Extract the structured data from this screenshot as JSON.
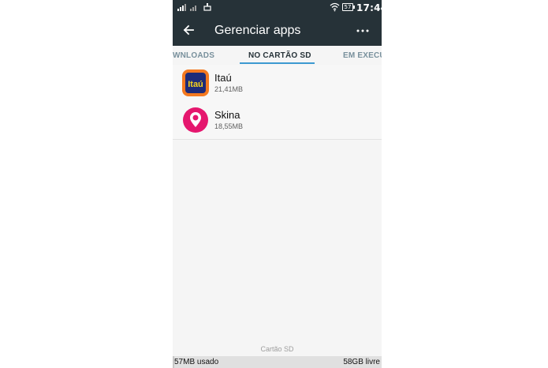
{
  "status_bar": {
    "time": "17:44",
    "battery": "57",
    "icons": [
      "signal-icon",
      "signal-icon",
      "usb-icon",
      "wifi-icon",
      "battery-icon"
    ]
  },
  "app_bar": {
    "title": "Gerenciar apps",
    "back_icon": "arrow-left-icon",
    "menu_icon": "more-horizontal-icon"
  },
  "tabs": [
    {
      "label": "WNLOADS"
    },
    {
      "label": "NO CARTÃO SD"
    },
    {
      "label": "EM EXECU"
    }
  ],
  "apps": [
    {
      "name": "Itaú",
      "size": "21,41MB",
      "icon": "itau-app-icon",
      "icon_text": "Itaú",
      "color": "#f47920"
    },
    {
      "name": "Skina",
      "size": "18,55MB",
      "icon": "skina-app-icon",
      "color": "#e5176e"
    }
  ],
  "storage": {
    "label": "Cartão SD",
    "used": "57MB usado",
    "free": "58GB livre"
  },
  "colors": {
    "app_bar": "#263238",
    "tab_indicator": "#3d9ad1"
  }
}
